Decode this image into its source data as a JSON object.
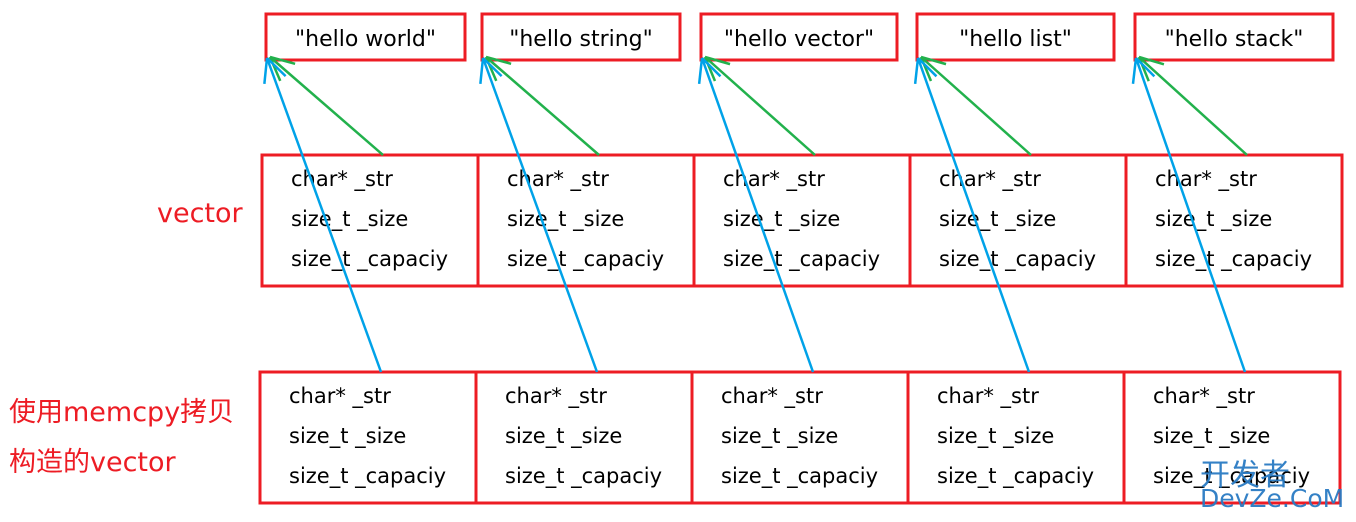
{
  "strings": [
    "\"hello world\"",
    "\"hello string\"",
    "\"hello vector\"",
    "\"hello list\"",
    "\"hello stack\""
  ],
  "fields": [
    "char* _str",
    "size_t _size",
    "size_t _capaciy"
  ],
  "labels": {
    "vector": "vector",
    "copy_line1": "使用memcpy拷贝",
    "copy_line2": "构造的vector"
  },
  "watermark": {
    "line1": "开发者",
    "line2": "DevZe.CoM"
  },
  "colors": {
    "box": "#ed1c24",
    "label": "#ed1c24",
    "green_arrow": "#22b14c",
    "blue_arrow": "#00a2e8",
    "text": "#000000"
  }
}
